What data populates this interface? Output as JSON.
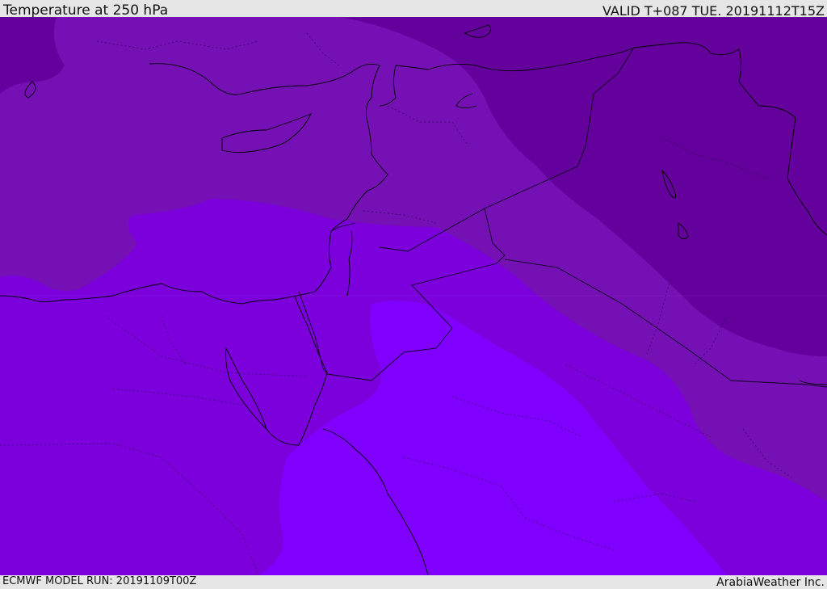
{
  "header": {
    "title": "Temperature at 250 hPa",
    "valid_time": "VALID T+087 TUE. 20191112T15Z"
  },
  "footer": {
    "model_run": "ECMWF MODEL RUN: 20191109T00Z",
    "credit": "ArabiaWeather Inc."
  },
  "colors": {
    "band_coldest": "#64009b",
    "band_cold": "#7510b5",
    "band_mid": "#7b00dc",
    "band_warm": "#7f00ff",
    "coastline": "#000000",
    "border": "#1a0033"
  }
}
